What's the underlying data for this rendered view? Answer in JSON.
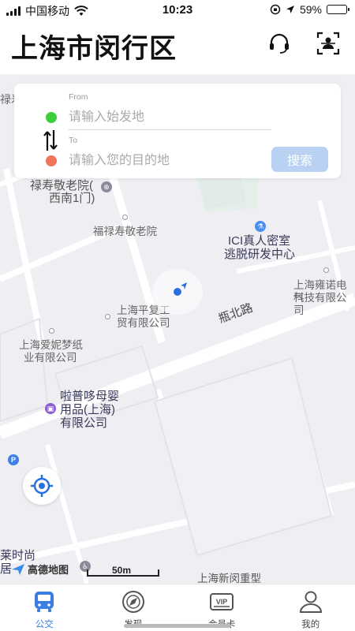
{
  "status_bar": {
    "carrier": "中国移动",
    "time": "10:23",
    "battery": "59%",
    "battery_level": 0.59
  },
  "header": {
    "title": "上海市闵行区",
    "support_icon": "headset-icon",
    "scan_icon": "face-scan-icon"
  },
  "search": {
    "from_caption": "From",
    "from_placeholder": "请输入始发地",
    "to_caption": "To",
    "to_placeholder": "请输入您的目的地",
    "search_label": "搜索",
    "from_color": "#3ccf3c",
    "to_color": "#f2735a",
    "button_color": "#b9d1f3"
  },
  "map": {
    "pois": [
      "禄寿敬老院(",
      "西南1门)",
      "福禄寿敬老院",
      "ICI真人密室",
      "逃脱研发中心",
      "上海雍诺电气",
      "科技有限公司",
      "上海平复工",
      "贸有限公司",
      "上海爱妮梦纸",
      "业有限公司",
      "啦普哆母婴",
      "用品(上海)",
      "有限公司",
      "上海新闵重型",
      "莱时尚",
      "居"
    ],
    "road": "瓶北路",
    "scale": "50m",
    "logo": "高德地图",
    "edge_text": "禄寿"
  },
  "tabs": [
    {
      "label": "公交",
      "icon": "bus-icon",
      "active": true
    },
    {
      "label": "发现",
      "icon": "compass-icon",
      "active": false
    },
    {
      "label": "会员卡",
      "icon": "vip-card-icon",
      "active": false
    },
    {
      "label": "我的",
      "icon": "user-icon",
      "active": false
    }
  ],
  "colors": {
    "accent": "#3b7de0",
    "map_bg": "#efeff3",
    "road": "#ffffff"
  }
}
